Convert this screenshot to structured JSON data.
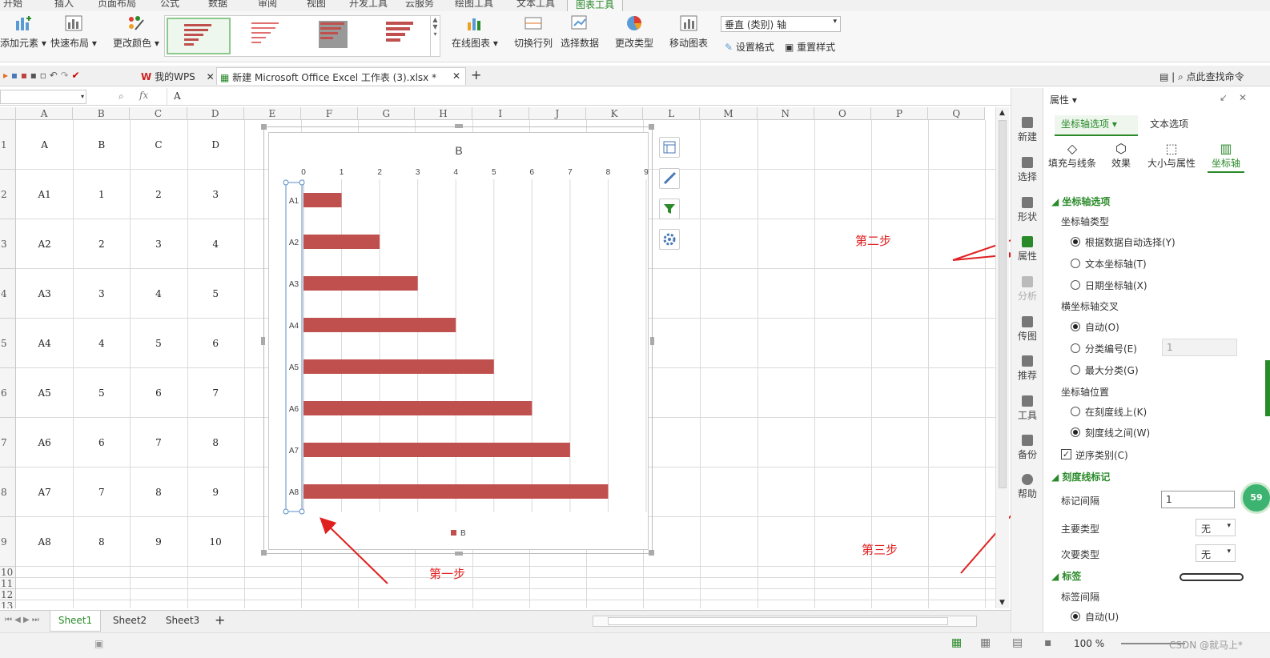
{
  "ribbon_tabs": [
    "开始",
    "插入",
    "页面布局",
    "公式",
    "数据",
    "审阅",
    "视图",
    "开发工具",
    "云服务",
    "绘图工具",
    "文本工具",
    "图表工具"
  ],
  "ribbon_buttons": {
    "add_element": "添加元素",
    "quick_layout": "快速布局",
    "change_color": "更改颜色",
    "online_chart": "在线图表",
    "switch_rowcol": "切换行列",
    "select_data": "选择数据",
    "change_type": "更改类型",
    "move_chart": "移动图表",
    "set_format": "设置格式",
    "reset_style": "重置样式"
  },
  "axis_selector": "垂直 (类别) 轴",
  "doc_tabs": {
    "wps": "我的WPS",
    "file": "新建 Microsoft Office Excel 工作表 (3).xlsx *",
    "add": "+"
  },
  "find_command": "点此查找命令",
  "formula_bar": {
    "fx": "fx",
    "value": "A"
  },
  "columns": [
    "A",
    "B",
    "C",
    "D",
    "E",
    "F",
    "G",
    "H",
    "I",
    "J",
    "K",
    "L",
    "M",
    "N",
    "O",
    "P",
    "Q"
  ],
  "rows": [
    "1",
    "2",
    "3",
    "4",
    "5",
    "6",
    "7",
    "8",
    "9",
    "10",
    "11",
    "12",
    "13"
  ],
  "table": [
    [
      "A",
      "B",
      "C",
      "D"
    ],
    [
      "A1",
      "1",
      "2",
      "3"
    ],
    [
      "A2",
      "2",
      "3",
      "4"
    ],
    [
      "A3",
      "3",
      "4",
      "5"
    ],
    [
      "A4",
      "4",
      "5",
      "6"
    ],
    [
      "A5",
      "5",
      "6",
      "7"
    ],
    [
      "A6",
      "6",
      "7",
      "8"
    ],
    [
      "A7",
      "7",
      "8",
      "9"
    ],
    [
      "A8",
      "8",
      "9",
      "10"
    ]
  ],
  "chart_data": {
    "type": "bar",
    "orientation": "horizontal",
    "title": "B",
    "categories": [
      "A1",
      "A2",
      "A3",
      "A4",
      "A5",
      "A6",
      "A7",
      "A8"
    ],
    "series": [
      {
        "name": "B",
        "values": [
          1,
          2,
          3,
          4,
          5,
          6,
          7,
          8
        ],
        "color": "#c0504d"
      }
    ],
    "xlim": [
      0,
      9
    ],
    "xticks": [
      "0",
      "1",
      "2",
      "3",
      "4",
      "5",
      "6",
      "7",
      "8",
      "9"
    ],
    "axis_position": "top",
    "reverse_categories": true,
    "grid": true,
    "legend": "bottom"
  },
  "annotations": {
    "step1": "第一步",
    "step2": "第二步",
    "step3": "第三步"
  },
  "sheets": [
    "Sheet1",
    "Sheet2",
    "Sheet3"
  ],
  "status": {
    "zoom": "100 %",
    "watermark": "CSDN @就马上*"
  },
  "side_items": [
    "新建",
    "选择",
    "形状",
    "属性",
    "分析",
    "传图",
    "推荐",
    "工具",
    "备份",
    "帮助"
  ],
  "panel": {
    "title": "属性",
    "tab_axis": "坐标轴选项",
    "tab_text": "文本选项",
    "subtabs": [
      "填充与线条",
      "效果",
      "大小与属性",
      "坐标轴"
    ],
    "section_axis": "坐标轴选项",
    "axis_type_label": "坐标轴类型",
    "axis_type_opts": [
      "根据数据自动选择(Y)",
      "文本坐标轴(T)",
      "日期坐标轴(X)"
    ],
    "cross_label": "横坐标轴交叉",
    "cross_opts": [
      "自动(O)",
      "分类编号(E)",
      "最大分类(G)"
    ],
    "cross_value": "1",
    "pos_label": "坐标轴位置",
    "pos_opts": [
      "在刻度线上(K)",
      "刻度线之间(W)"
    ],
    "reverse_label": "逆序类别(C)",
    "section_tick": "刻度线标记",
    "interval_label": "标记间隔",
    "interval_value": "1",
    "major_label": "主要类型",
    "major_value": "无",
    "minor_label": "次要类型",
    "minor_value": "无",
    "section_label": "标签",
    "label_interval_label": "标签间隔",
    "label_interval_auto": "自动(U)",
    "badge": "59"
  }
}
